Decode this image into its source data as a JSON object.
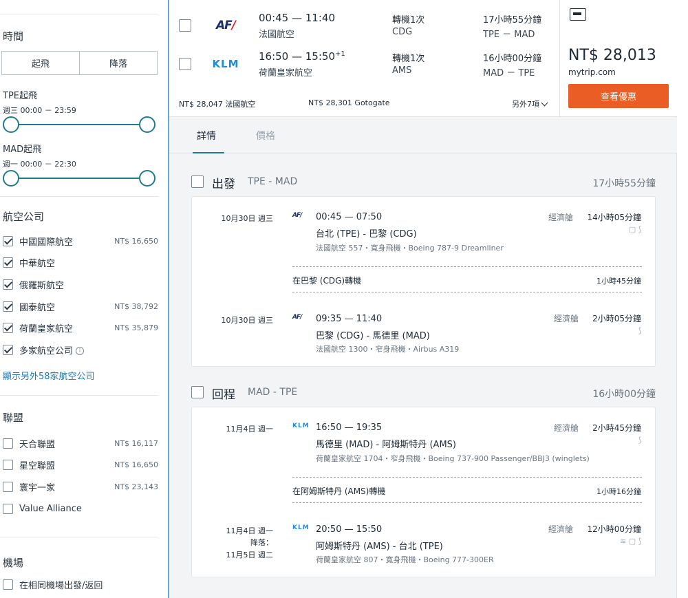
{
  "sidebar": {
    "time_heading": "時間",
    "segment": [
      "起飛",
      "降落"
    ],
    "tpe_label": "TPE起飛",
    "tpe_range": "週三 00:00 － 23:59",
    "mad_label": "MAD起飛",
    "mad_range": "週一 00:00 － 22:30",
    "airlines_heading": "航空公司",
    "airlines": [
      {
        "name": "中國國際航空",
        "price": "NT$ 16,650",
        "checked": true
      },
      {
        "name": "中華航空",
        "price": "",
        "checked": true
      },
      {
        "name": "俄羅斯航空",
        "price": "",
        "checked": true
      },
      {
        "name": "國泰航空",
        "price": "NT$ 38,792",
        "checked": true
      },
      {
        "name": "荷蘭皇家航空",
        "price": "NT$ 35,879",
        "checked": true
      },
      {
        "name": "多家航空公司",
        "price": "",
        "checked": true
      }
    ],
    "info_glyph": "i",
    "more_airlines_link": "顯示另外58家航空公司",
    "alliance_heading": "聯盟",
    "alliances": [
      {
        "name": "天合聯盟",
        "price": "NT$ 16,117"
      },
      {
        "name": "星空聯盟",
        "price": "NT$ 16,650"
      },
      {
        "name": "寰宇一家",
        "price": "NT$ 23,143"
      },
      {
        "name": "Value Alliance",
        "price": ""
      }
    ],
    "airport_heading": "機場",
    "same_airport": "在相同機場出發/返回"
  },
  "result": {
    "outbound": {
      "logo": "AF",
      "times": "00:45 — 11:40",
      "airline": "法國航空",
      "stops": "轉機1次",
      "via": "CDG",
      "duration": "17小時55分鐘",
      "route": "TPE － MAD"
    },
    "inbound": {
      "logo": "KLM",
      "times": "16:50 — 15:50",
      "day_offset": "+1",
      "airline": "荷蘭皇家航空",
      "stops": "轉機1次",
      "via": "AMS",
      "duration": "16小時00分鐘",
      "route": "MAD － TPE"
    },
    "alt_price_1": "NT$ 28,047 法國航空",
    "alt_price_2": "NT$ 28,301 Gotogate",
    "more_options": "另外7項",
    "price": "NT$ 28,013",
    "vendor": "mytrip.com",
    "deal_button": "查看優惠"
  },
  "tabs": [
    "詳情",
    "價格"
  ],
  "depart": {
    "title": "出發",
    "route": "TPE - MAD",
    "duration": "17小時55分鐘",
    "legs": [
      {
        "date": "10月30日 週三",
        "logo": "AF",
        "time": "00:45 — 07:50",
        "cities": "台北 (TPE) - 巴黎 (CDG)",
        "detail": "法國航空 557・寬身飛機・Boeing 787-9 Dreamliner",
        "cabin": "經濟艙",
        "duration": "14小時05分鐘",
        "amenities": "▢ ⟆"
      },
      {
        "date": "10月30日 週三",
        "logo": "AF",
        "time": "09:35 — 11:40",
        "cities": "巴黎 (CDG) - 馬德里 (MAD)",
        "detail": "法國航空 1300・窄身飛機・Airbus A319",
        "cabin": "經濟艙",
        "duration": "2小時05分鐘",
        "amenities": "⟆"
      }
    ],
    "connection": "在巴黎 (CDG)轉機",
    "connection_duration": "1小時45分鐘"
  },
  "return": {
    "title": "回程",
    "route": "MAD - TPE",
    "duration": "16小時00分鐘",
    "legs": [
      {
        "date": "11月4日 週一",
        "logo": "KLM",
        "time": "16:50 — 19:35",
        "cities": "馬德里 (MAD) - 阿姆斯特丹 (AMS)",
        "detail": "荷蘭皇家航空 1704・窄身飛機・Boeing 737-900 Passenger/BBJ3 (winglets)",
        "cabin": "經濟艙",
        "duration": "2小時45分鐘",
        "amenities": "⟆"
      },
      {
        "date": "11月4日 週一",
        "arrive_label": "降落：",
        "arrive_date": "11月5日 週二",
        "logo": "KLM",
        "time": "20:50 — 15:50",
        "cities": "阿姆斯特丹 (AMS) - 台北 (TPE)",
        "detail": "荷蘭皇家航空 807・寬身飛機・Boeing 777-300ER",
        "cabin": "經濟艙",
        "duration": "12小時00分鐘",
        "amenities": "≋ ▢ ⟆"
      }
    ],
    "connection": "在阿姆斯特丹 (AMS)轉機",
    "connection_duration": "1小時16分鐘"
  }
}
